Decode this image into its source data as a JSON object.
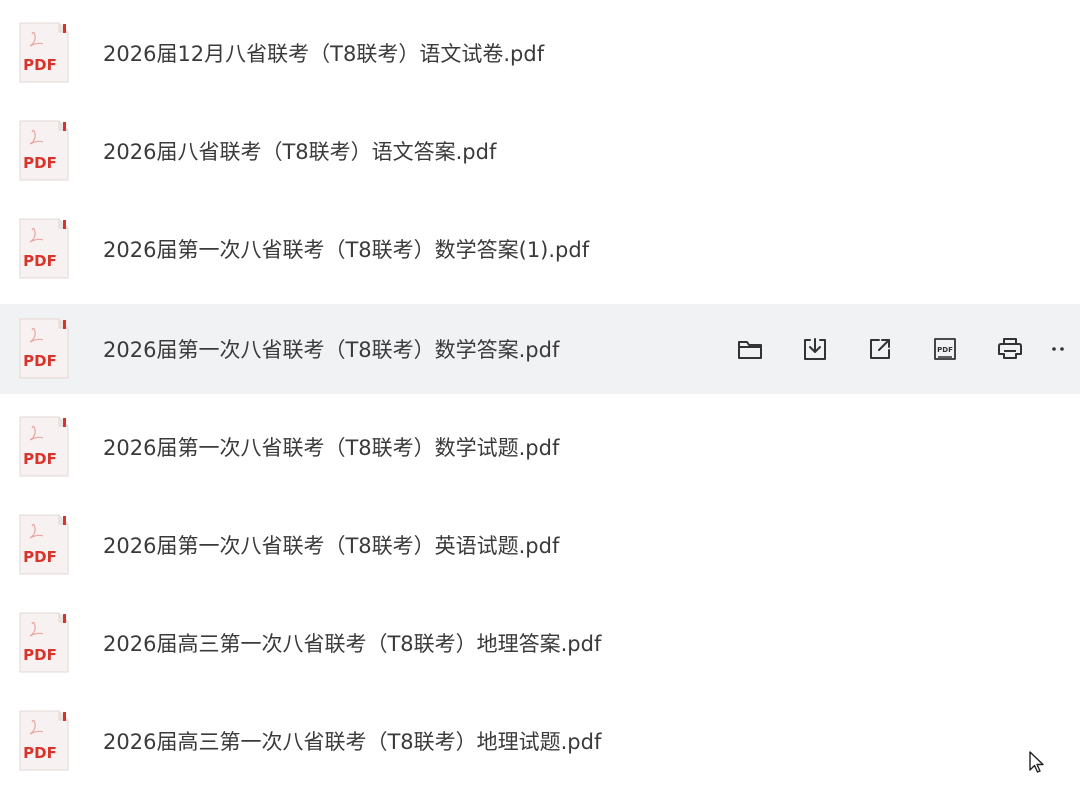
{
  "files": [
    {
      "name": "2026届12月八省联考（T8联考）语文试卷.pdf",
      "icon": "pdf-file-icon",
      "icon_label": "PDF"
    },
    {
      "name": "2026届八省联考（T8联考）语文答案.pdf",
      "icon": "pdf-file-icon",
      "icon_label": "PDF"
    },
    {
      "name": "2026届第一次八省联考（T8联考）数学答案(1).pdf",
      "icon": "pdf-file-icon",
      "icon_label": "PDF"
    },
    {
      "name": "2026届第一次八省联考（T8联考）数学答案.pdf",
      "icon": "pdf-file-icon",
      "icon_label": "PDF"
    },
    {
      "name": "2026届第一次八省联考（T8联考）数学试题.pdf",
      "icon": "pdf-file-icon",
      "icon_label": "PDF"
    },
    {
      "name": "2026届第一次八省联考（T8联考）英语试题.pdf",
      "icon": "pdf-file-icon",
      "icon_label": "PDF"
    },
    {
      "name": "2026届高三第一次八省联考（T8联考）地理答案.pdf",
      "icon": "pdf-file-icon",
      "icon_label": "PDF"
    },
    {
      "name": "2026届高三第一次八省联考（T8联考）地理试题.pdf",
      "icon": "pdf-file-icon",
      "icon_label": "PDF"
    }
  ],
  "hovered_row_index": 3,
  "row_actions": [
    {
      "name": "folder-icon"
    },
    {
      "name": "download-icon"
    },
    {
      "name": "external-link-icon"
    },
    {
      "name": "pdf-convert-icon",
      "label": "PDF"
    },
    {
      "name": "print-icon"
    },
    {
      "name": "more-icon"
    }
  ],
  "colors": {
    "hover_background": "#f1f2f4",
    "text": "#3a3a3a",
    "icon_stroke": "#333333",
    "pdf_red": "#d9342b",
    "pdf_page": "#f7f2f1"
  }
}
